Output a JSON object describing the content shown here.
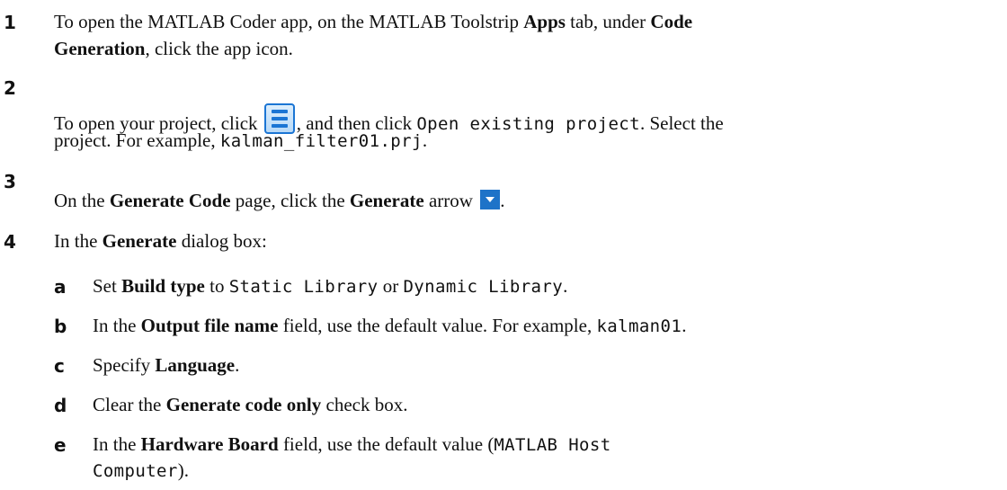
{
  "steps": [
    {
      "number": "1",
      "line1": {
        "t1": "To open the MATLAB Coder app, on the MATLAB Toolstrip ",
        "b1": "Apps",
        "t2": " tab, under ",
        "b2": "Code"
      },
      "line2": {
        "b1": "Generation",
        "t1": ", click the app icon."
      }
    },
    {
      "number": "2",
      "line1": {
        "t1": "To open your project, click ",
        "icon": "menu-icon",
        "t2": ", and then click ",
        "c1": "Open existing project",
        "t3": ". Select the"
      },
      "line2": {
        "t1": "project. For example, ",
        "c1": "kalman_filter01.prj",
        "t2": "."
      }
    },
    {
      "number": "3",
      "line1": {
        "t1": "On the ",
        "b1": "Generate Code",
        "t2": " page, click the ",
        "b2": "Generate",
        "t3": " arrow ",
        "icon": "dropdown-arrow-icon",
        "t4": "."
      }
    },
    {
      "number": "4",
      "line1": {
        "t1": "In the ",
        "b1": "Generate",
        "t2": " dialog box:"
      },
      "substeps": [
        {
          "letter": "a",
          "t1": "Set ",
          "b1": "Build type",
          "t2": " to ",
          "c1": "Static Library",
          "t3": " or ",
          "c2": "Dynamic Library",
          "t4": "."
        },
        {
          "letter": "b",
          "t1": "In the ",
          "b1": "Output file name",
          "t2": " field, use the default value. For example, ",
          "c1": "kalman01",
          "t3": "."
        },
        {
          "letter": "c",
          "t1": "Specify ",
          "b1": "Language",
          "t2": "."
        },
        {
          "letter": "d",
          "t1": "Clear the ",
          "b1": "Generate code only",
          "t2": " check box."
        },
        {
          "letter": "e",
          "t1": "In the ",
          "b1": "Hardware Board",
          "t2": " field, use the default value (",
          "c1": "MATLAB Host",
          "c2": "Computer",
          "t3": ")."
        }
      ]
    }
  ]
}
